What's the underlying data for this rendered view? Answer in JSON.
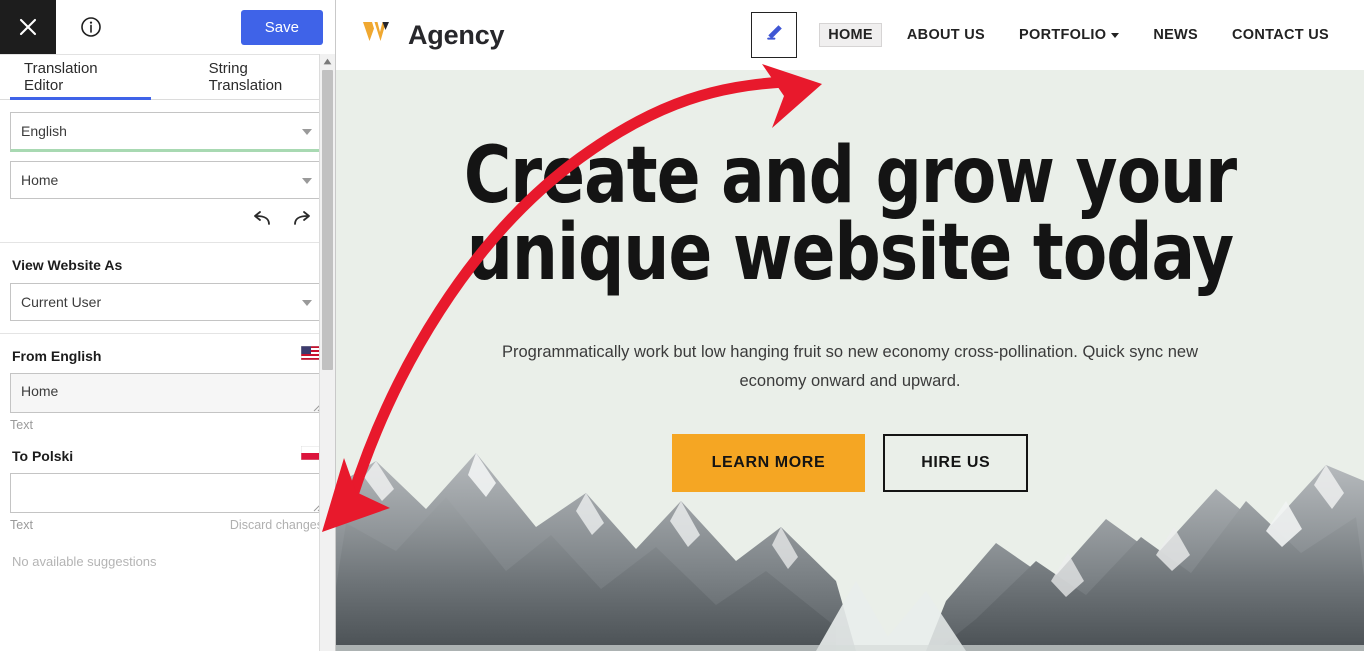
{
  "sidebar": {
    "topbar": {
      "close_icon": "close-icon",
      "info_icon": "info-circle-icon",
      "save_label": "Save"
    },
    "tabs": [
      {
        "label": "Translation Editor",
        "active": true
      },
      {
        "label": "String Translation",
        "active": false
      }
    ],
    "language_select": {
      "value": "English",
      "icon": "chevron-down-icon"
    },
    "page_select": {
      "value": "Home",
      "icon": "chevron-down-icon"
    },
    "history": {
      "undo_icon": "undo-arrow-icon",
      "redo_icon": "redo-arrow-icon"
    },
    "view_website_as": {
      "title": "View Website As",
      "value": "Current User"
    },
    "source": {
      "label": "From English",
      "flag": "flag-us-icon",
      "value": "Home",
      "hint": "Text"
    },
    "target": {
      "label": "To Polski",
      "flag": "flag-pl-icon",
      "value": "",
      "placeholder": "",
      "hint": "Text",
      "discard_label": "Discard changes"
    },
    "suggestions_text": "No available suggestions",
    "scrollbar": {
      "up_icon": "scroll-up-arrow-icon"
    }
  },
  "preview": {
    "brand": {
      "logo_icon": "w-logo-icon",
      "name": "Agency"
    },
    "edit_button": {
      "icon": "pencil-edit-icon"
    },
    "nav": [
      {
        "label": "HOME",
        "highlight": true,
        "has_chevron": false
      },
      {
        "label": "ABOUT US",
        "highlight": false,
        "has_chevron": false
      },
      {
        "label": "PORTFOLIO",
        "highlight": false,
        "has_chevron": true
      },
      {
        "label": "NEWS",
        "highlight": false,
        "has_chevron": false
      },
      {
        "label": "CONTACT US",
        "highlight": false,
        "has_chevron": false
      }
    ],
    "hero": {
      "title_line1": "Create and grow your",
      "title_line2": "unique website today",
      "subtitle": "Programmatically work but low hanging fruit so new economy cross-pollination. Quick sync new economy onward and upward.",
      "primary_button": "LEARN MORE",
      "secondary_button": "HIRE US",
      "background_color": "#eaefe9"
    }
  },
  "annotation": {
    "arrow_color": "#e8192c",
    "name": "red-curved-double-arrow"
  },
  "colors": {
    "accent_blue": "#3f63e8",
    "accent_orange": "#f5a623",
    "valid_green": "#a8d9b2",
    "hero_bg": "#eaefe9",
    "arrow_red": "#e8192c"
  }
}
